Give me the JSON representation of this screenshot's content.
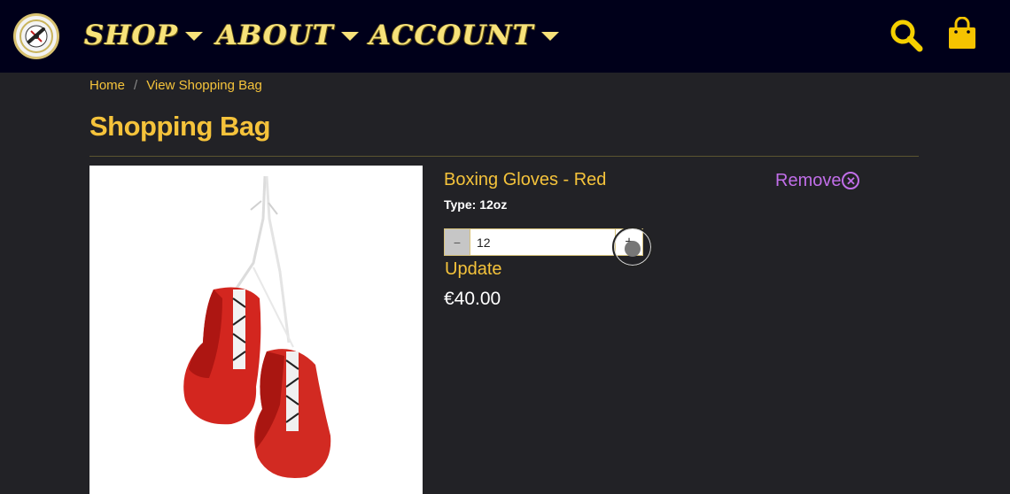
{
  "navbar": {
    "logo_icon": "boxing-club-logo",
    "items": [
      {
        "label": "SHOP"
      },
      {
        "label": "ABOUT"
      },
      {
        "label": "ACCOUNT"
      }
    ],
    "search_icon": "search-icon",
    "bag_icon": "shopping-bag-icon"
  },
  "breadcrumb": {
    "home": "Home",
    "separator": "/",
    "current": "View Shopping Bag"
  },
  "page": {
    "title": "Shopping Bag"
  },
  "cart_item": {
    "name": "Boxing Gloves - Red",
    "type_label": "Type: 12oz",
    "remove_label": "Remove",
    "remove_icon": "close-circle-icon",
    "quantity": "12",
    "minus_label": "−",
    "plus_label": "+",
    "update_label": "Update",
    "price": "€40.00",
    "image_icon": "red-boxing-gloves-image"
  },
  "colors": {
    "navbar_bg": "#00001a",
    "page_bg": "#222226",
    "accent": "#f5c33b",
    "remove": "#c16ee8"
  }
}
